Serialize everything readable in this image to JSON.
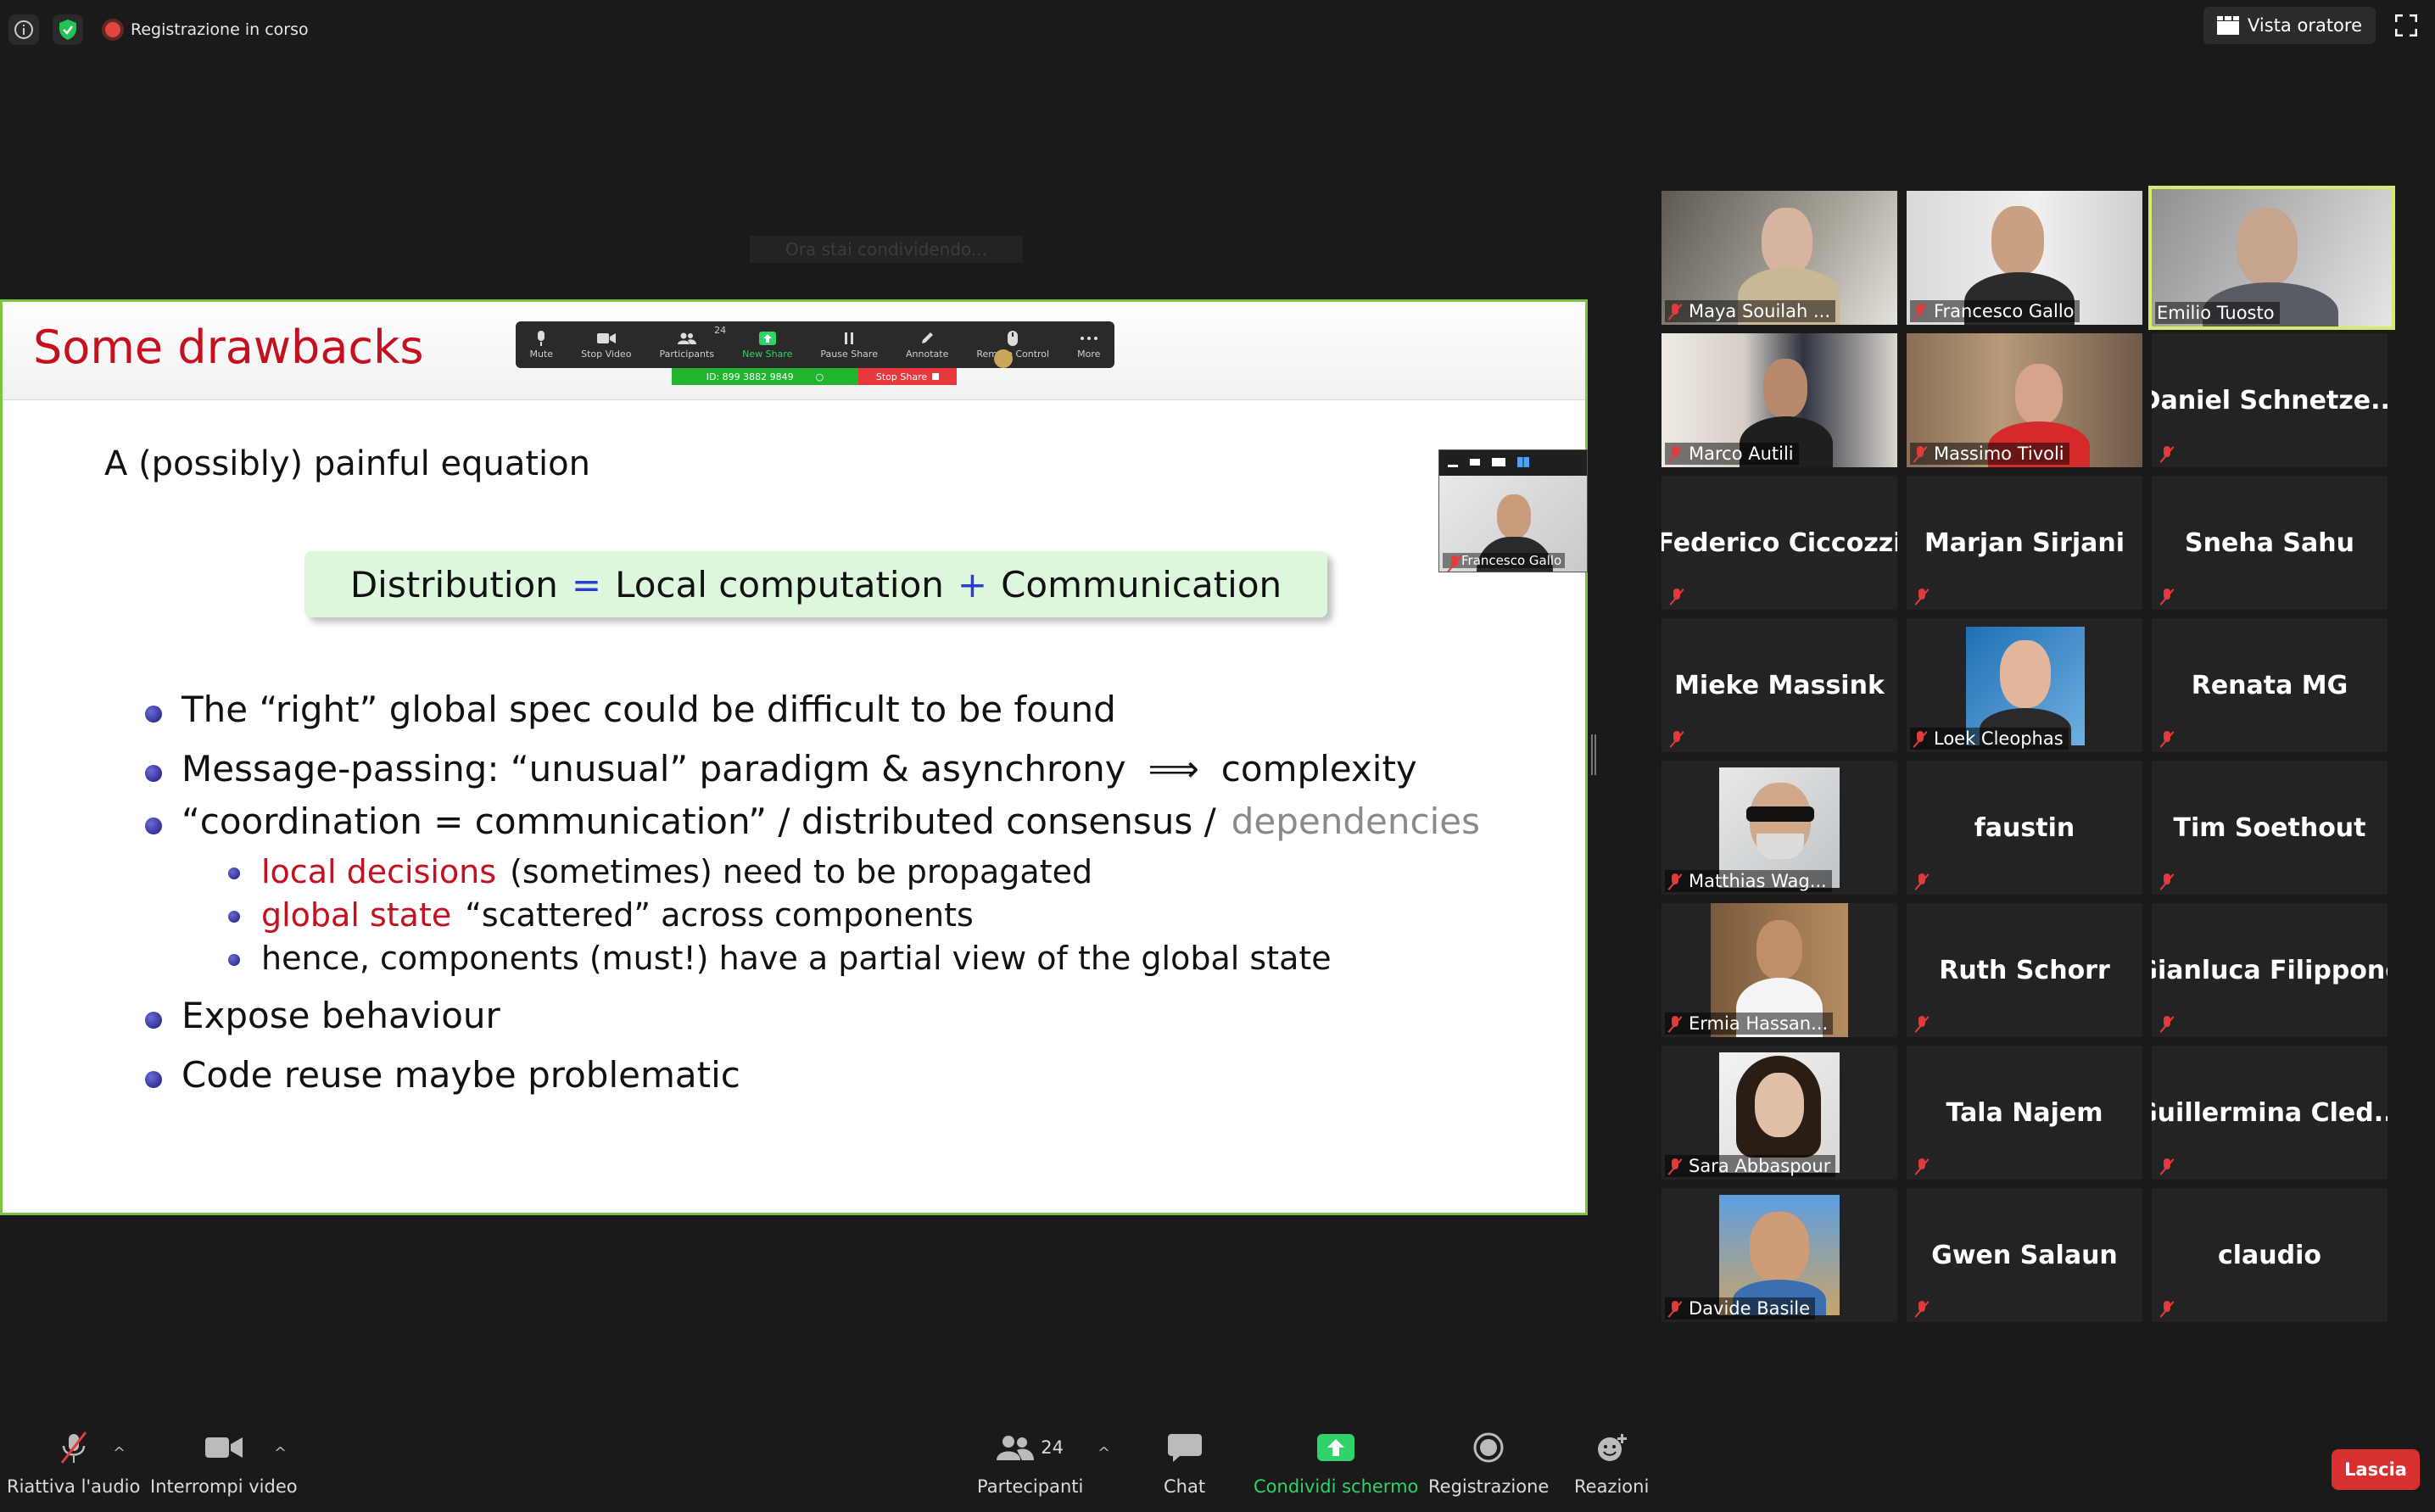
{
  "topbar": {
    "recording_label": "Registrazione in corso",
    "speaker_view_label": "Vista oratore",
    "icons": [
      "info-icon",
      "shield-check-icon",
      "recording-dot-icon",
      "speaker-view-icon",
      "fullscreen-icon"
    ]
  },
  "ghost_label": "Ora stai condividendo...",
  "slide": {
    "title": "Some drawbacks",
    "intro": "A (possibly) painful equation",
    "equation": {
      "left": "Distribution",
      "eq": "=",
      "a": "Local computation",
      "plus": "+",
      "b": "Communication"
    },
    "bullet1": "The “right” global spec could be difficult to be found",
    "bullet2_a": "Message-passing:  “unusual”  paradigm & asynchrony",
    "bullet2_arrow": "⟹",
    "bullet2_b": "complexity",
    "bullet3_a": "“coordination = communication”  /  distributed consensus  /",
    "bullet3_b": "dependencies",
    "sub1_red": "local decisions",
    "sub1_rest": "(sometimes) need to be propagated",
    "sub2_red": "global state",
    "sub2_rest": "“scattered”  across components",
    "sub3": "hence, components (must!) have a partial view of the global state",
    "bullet4": "Expose behaviour",
    "bullet5": "Code reuse maybe problematic"
  },
  "share_toolbar": {
    "items": [
      "Mute",
      "Stop Video",
      "Participants",
      "New Share",
      "Pause Share",
      "Annotate",
      "Remote Control",
      "More"
    ],
    "participants_count": "24",
    "meeting_id": "ID: 899 3882 9849",
    "stop_share": "Stop Share"
  },
  "mini_view": {
    "name": "Francesco Gallo"
  },
  "gallery": {
    "tiles": [
      {
        "name": "Maya Souilah ...",
        "video": true
      },
      {
        "name": "Francesco Gallo",
        "video": true
      },
      {
        "name": "Emilio Tuosto",
        "video": true,
        "active": true
      },
      {
        "name": "Marco Autili",
        "video": true
      },
      {
        "name": "Massimo Tivoli",
        "video": true
      },
      {
        "name": "Daniel  Schnetze...",
        "video": false
      },
      {
        "name": "Federico Ciccozzi",
        "video": false
      },
      {
        "name": "Marjan Sirjani",
        "video": false
      },
      {
        "name": "Sneha Sahu",
        "video": false
      },
      {
        "name": "Mieke Massink",
        "video": false
      },
      {
        "name": "Loek Cleophas",
        "video": "photo"
      },
      {
        "name": "Renata MG",
        "video": false
      },
      {
        "name": "Matthias Wag...",
        "video": "photo"
      },
      {
        "name": "faustin",
        "video": false
      },
      {
        "name": "Tim Soethout",
        "video": false
      },
      {
        "name": "Ermia Hassan...",
        "video": "photo"
      },
      {
        "name": "Ruth Schorr",
        "video": false
      },
      {
        "name": "Gianluca Filippone",
        "video": false
      },
      {
        "name": "Sara Abbaspour",
        "video": "photo"
      },
      {
        "name": "Tala Najem",
        "video": false
      },
      {
        "name": "Guillermina  Cled...",
        "video": false
      },
      {
        "name": "Davide Basile",
        "video": "photo"
      },
      {
        "name": "Gwen Salaun",
        "video": false
      },
      {
        "name": "claudio",
        "video": false
      }
    ]
  },
  "bottom_bar": {
    "unmute": "Riattiva l'audio",
    "stop_video": "Interrompi video",
    "participants": "Partecipanti",
    "participants_count": "24",
    "chat": "Chat",
    "share_screen": "Condividi schermo",
    "record": "Registrazione",
    "reactions": "Reazioni",
    "leave": "Lascia"
  },
  "colors": {
    "share_green": "#2fd36a",
    "active_border": "#d9e96a",
    "slide_red": "#c5101f",
    "equation_blue": "#2b3bd6",
    "leave_red": "#d8302f"
  }
}
